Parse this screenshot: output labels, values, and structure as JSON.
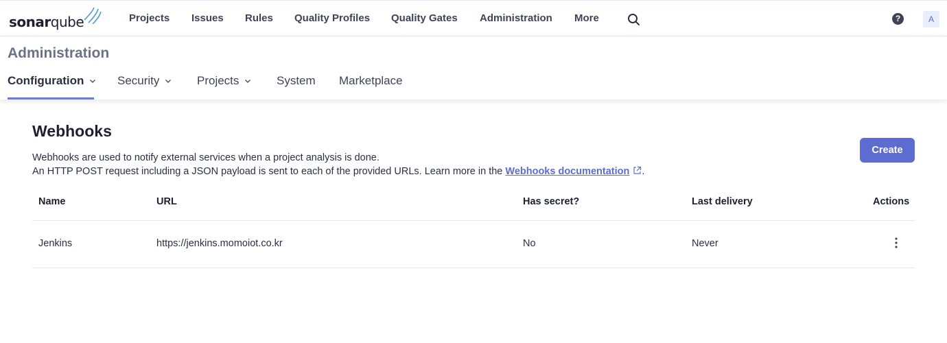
{
  "brand": {
    "logo_bold": "sonar",
    "logo_light": "qube"
  },
  "topnav": {
    "items": [
      {
        "label": "Projects"
      },
      {
        "label": "Issues"
      },
      {
        "label": "Rules"
      },
      {
        "label": "Quality Profiles"
      },
      {
        "label": "Quality Gates"
      },
      {
        "label": "Administration"
      },
      {
        "label": "More"
      }
    ],
    "search_icon": "search-icon",
    "help_label": "?",
    "avatar_initial": "A"
  },
  "admin": {
    "title": "Administration",
    "tabs": [
      {
        "label": "Configuration",
        "has_dropdown": true,
        "active": true
      },
      {
        "label": "Security",
        "has_dropdown": true
      },
      {
        "label": "Projects",
        "has_dropdown": true
      },
      {
        "label": "System",
        "has_dropdown": false
      },
      {
        "label": "Marketplace",
        "has_dropdown": false
      }
    ]
  },
  "webhooks": {
    "title": "Webhooks",
    "description_line1": "Webhooks are used to notify external services when a project analysis is done.",
    "description_line2_prefix": "An HTTP POST request including a JSON payload is sent to each of the provided URLs. Learn more in the ",
    "doc_link_label": "Webhooks documentation",
    "description_line2_suffix": ".",
    "create_label": "Create",
    "table": {
      "headers": {
        "name": "Name",
        "url": "URL",
        "secret": "Has secret?",
        "last_delivery": "Last delivery",
        "actions": "Actions"
      },
      "rows": [
        {
          "name": "Jenkins",
          "url": "https://jenkins.momoiot.co.kr",
          "secret": "No",
          "last_delivery": "Never"
        }
      ]
    }
  },
  "colors": {
    "accent": "#5d6cd0",
    "tab_underline": "#6a7bd6",
    "text": "#2a2f40",
    "muted_title": "#6a7189"
  }
}
